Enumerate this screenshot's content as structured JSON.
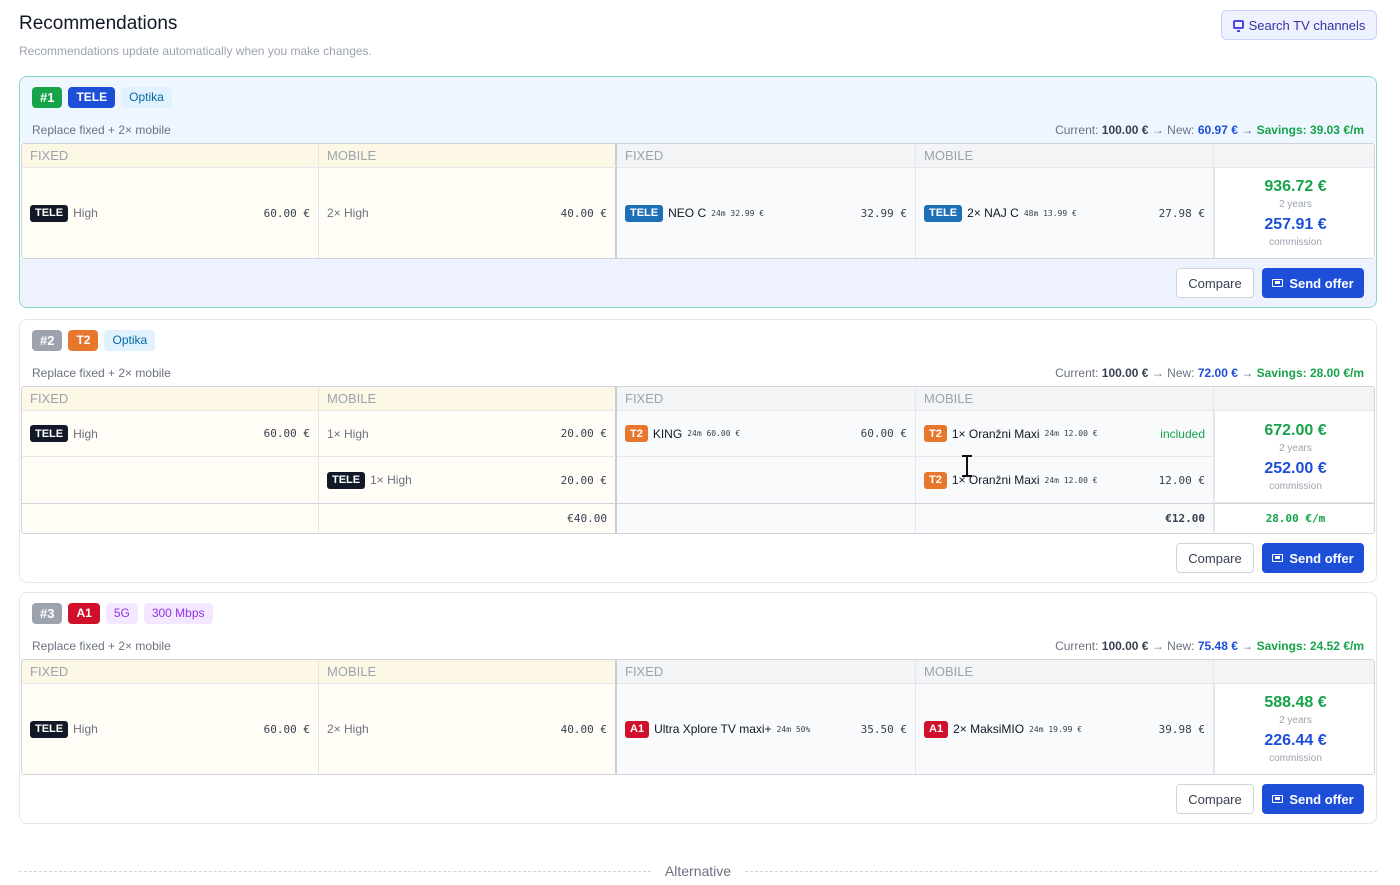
{
  "header": {
    "title": "Recommendations",
    "subtitle": "Recommendations update automatically when you make changes.",
    "search_label": "Search TV channels",
    "search_icon": "tv-icon"
  },
  "columns": {
    "fixed": "FIXED",
    "mobile": "MOBILE"
  },
  "labels": {
    "current": "Current:",
    "new": "New:",
    "savings": "Savings:",
    "arrow": "→",
    "years": "2 years",
    "commission": "commission",
    "compare": "Compare",
    "send_offer": "Send offer",
    "included": "included",
    "alternative": "Alternative"
  },
  "colors": {
    "primary_blue": "#1d4ed8",
    "savings_green": "#16a34a",
    "tele": "#1d6fb8",
    "t2": "#e8772e",
    "a1": "#d0102b"
  },
  "offers": [
    {
      "rank": "#1",
      "provider": "TELE",
      "tags": [
        "Optika"
      ],
      "description": "Replace fixed + 2× mobile",
      "current": "100.00 €",
      "new": "60.97 €",
      "savings": "39.03 €/m",
      "current_fixed": {
        "provider": "TELE",
        "label": "High",
        "price": "60.00 €"
      },
      "current_mobile": {
        "label": "2× High",
        "price": "40.00 €"
      },
      "new_fixed": {
        "provider": "TELE",
        "label": "NEO C",
        "term": "24m 32.99 €",
        "price": "32.99 €"
      },
      "new_mobile": {
        "provider": "TELE",
        "label": "2× NAJ C",
        "term": "48m 13.99 €",
        "price": "27.98 €"
      },
      "total": "936.72 €",
      "commission": "257.91 €"
    },
    {
      "rank": "#2",
      "provider": "T2",
      "tags": [
        "Optika"
      ],
      "description": "Replace fixed + 2× mobile",
      "current": "100.00 €",
      "new": "72.00 €",
      "savings": "28.00 €/m",
      "row1": {
        "current_fixed": {
          "provider": "TELE",
          "label": "High",
          "price": "60.00 €"
        },
        "current_mobile": {
          "label": "1× High",
          "price": "20.00 €"
        },
        "new_fixed": {
          "provider": "T2",
          "label": "KING",
          "term": "24m 60.00 €",
          "price": "60.00 €"
        },
        "new_mobile": {
          "provider": "T2",
          "label": "1× Oranžni Maxi",
          "term": "24m 12.00 €"
        }
      },
      "row2": {
        "current_mobile": {
          "provider": "TELE",
          "label": "1× High",
          "price": "20.00 €"
        },
        "new_mobile": {
          "provider": "T2",
          "label": "1× Oranžni Maxi",
          "term": "24m 12.00 €",
          "price": "12.00 €"
        }
      },
      "totals_row": {
        "current": "€40.00",
        "new": "€12.00",
        "savings": "28.00 €/m"
      },
      "total": "672.00 €",
      "commission": "252.00 €"
    },
    {
      "rank": "#3",
      "provider": "A1",
      "tags": [
        "5G",
        "300 Mbps"
      ],
      "description": "Replace fixed + 2× mobile",
      "current": "100.00 €",
      "new": "75.48 €",
      "savings": "24.52 €/m",
      "current_fixed": {
        "provider": "TELE",
        "label": "High",
        "price": "60.00 €"
      },
      "current_mobile": {
        "label": "2× High",
        "price": "40.00 €"
      },
      "new_fixed": {
        "provider": "A1",
        "label": "Ultra Xplore TV maxi+",
        "term": "24m 50%",
        "price": "35.50 €"
      },
      "new_mobile": {
        "provider": "A1",
        "label": "2× MaksiMIO",
        "term": "24m 19.99 €",
        "price": "39.98 €"
      },
      "total": "588.48 €",
      "commission": "226.44 €"
    }
  ]
}
